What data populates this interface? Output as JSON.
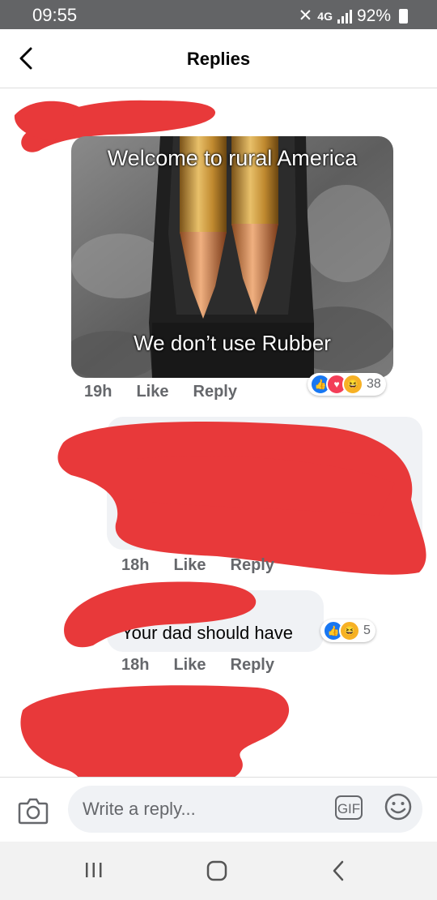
{
  "status_bar": {
    "time": "09:55",
    "network": "4G",
    "battery": "92%"
  },
  "header": {
    "title": "Replies",
    "back_icon": "chevron-left-icon"
  },
  "comments": [
    {
      "image": {
        "top_text": "Welcome to rural America",
        "bottom_text": "We don’t use Rubber"
      },
      "time": "19h",
      "like_label": "Like",
      "reply_label": "Reply",
      "reactions": [
        "like",
        "love",
        "haha"
      ],
      "reaction_count": "38"
    },
    {
      "time": "18h",
      "like_label": "Like",
      "reply_label": "Reply"
    },
    {
      "text": "Your dad should have",
      "time": "18h",
      "like_label": "Like",
      "reply_label": "Reply",
      "reactions": [
        "like",
        "haha"
      ],
      "reaction_count": "5"
    }
  ],
  "composer": {
    "placeholder": "Write a reply...",
    "gif_label": "GIF",
    "camera_icon": "camera-icon",
    "emoji_icon": "smiley-icon"
  },
  "navigation": {
    "recents": "recent-apps-icon",
    "home": "home-icon",
    "back": "back-icon"
  },
  "colors": {
    "redaction": "#e8393a",
    "like_blue": "#1877f2",
    "love_red": "#f33e58",
    "haha_yellow": "#f7b125",
    "status_bar": "#636466"
  }
}
